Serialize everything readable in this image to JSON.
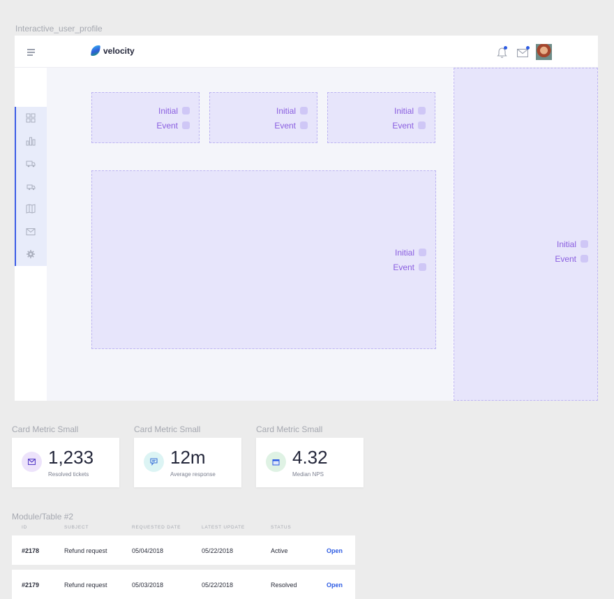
{
  "frame_title": "Interactive_user_profile",
  "brand": {
    "name": "velocity"
  },
  "header": {
    "icons": [
      "menu-icon",
      "bell-icon",
      "mail-icon",
      "avatar"
    ],
    "notification_badge": true,
    "mail_badge": true
  },
  "sidebar": {
    "items": [
      {
        "icon": "grid-icon"
      },
      {
        "icon": "bar-chart-icon"
      },
      {
        "icon": "truck-icon"
      },
      {
        "icon": "delivery-truck-icon"
      },
      {
        "icon": "map-icon"
      },
      {
        "icon": "envelope-icon"
      },
      {
        "icon": "gear-icon"
      }
    ]
  },
  "slots": [
    {
      "initial": "Initial",
      "event": "Event"
    },
    {
      "initial": "Initial",
      "event": "Event"
    },
    {
      "initial": "Initial",
      "event": "Event"
    },
    {
      "initial": "Initial",
      "event": "Event"
    },
    {
      "initial": "Initial",
      "event": "Event"
    }
  ],
  "metrics": [
    {
      "section": "Card Metric Small",
      "value": "1,233",
      "desc": "Resolved tickets",
      "icon": "mail-icon",
      "color": "#ede3fb"
    },
    {
      "section": "Card Metric Small",
      "value": "12m",
      "desc": "Average response",
      "icon": "chat-icon",
      "color": "#dcf4f4"
    },
    {
      "section": "Card Metric Small",
      "value": "4.32",
      "desc": "Median NPS",
      "icon": "calendar-icon",
      "color": "#dff2e4"
    }
  ],
  "table": {
    "title": "Module/Table #2",
    "headers": [
      "ID",
      "SUBJECT",
      "REQUESTED DATE",
      "LATEST UPDATE",
      "STATUS"
    ],
    "rows": [
      {
        "id": "#2178",
        "subject": "Refund request",
        "requested": "05/04/2018",
        "updated": "05/22/2018",
        "status": "Active",
        "action": "Open"
      },
      {
        "id": "#2179",
        "subject": "Refund request",
        "requested": "05/03/2018",
        "updated": "05/22/2018",
        "status": "Resolved",
        "action": "Open"
      }
    ]
  },
  "colors": {
    "accent": "#2d5be3",
    "slot_fill": "#e7e5fb",
    "slot_text": "#8a5ee0"
  }
}
